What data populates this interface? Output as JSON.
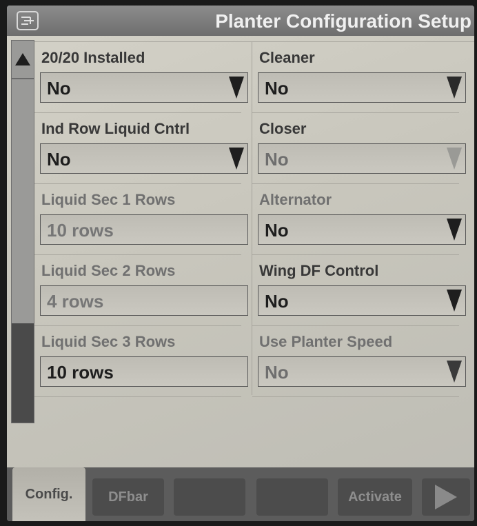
{
  "header": {
    "title": "Planter Configuration Setup",
    "icon": "machine-settings-icon"
  },
  "left_column": [
    {
      "label": "20/20 Installed",
      "value": "No",
      "kind": "dropdown"
    },
    {
      "label": "Ind Row Liquid Cntrl",
      "value": "No",
      "kind": "dropdown"
    },
    {
      "label": "Liquid Sec 1 Rows",
      "value": "10  rows",
      "kind": "field",
      "disabled": true
    },
    {
      "label": "Liquid Sec 2 Rows",
      "value": "4  rows",
      "kind": "field",
      "disabled": true
    },
    {
      "label": "Liquid Sec 3 Rows",
      "value": "10  rows",
      "kind": "field",
      "disabled": false
    }
  ],
  "right_column": [
    {
      "label": "Cleaner",
      "value": "No",
      "kind": "dropdown"
    },
    {
      "label": "Closer",
      "value": "No",
      "kind": "dropdown",
      "disabled": true
    },
    {
      "label": "Alternator",
      "value": "No",
      "kind": "dropdown"
    },
    {
      "label": "Wing DF Control",
      "value": "No",
      "kind": "dropdown"
    },
    {
      "label": "Use Planter Speed",
      "value": "No",
      "kind": "dropdown",
      "disabled": true
    }
  ],
  "tabs": [
    {
      "label": "Config.",
      "active": true
    },
    {
      "label": "DFbar"
    },
    {
      "label": ""
    },
    {
      "label": ""
    },
    {
      "label": "Activate"
    }
  ],
  "colors": {
    "screen_bg": "#c8c6bc",
    "title_bar": "#7a7a7a",
    "footer": "#5c5c5c",
    "thumb": "#4a4a4a"
  }
}
